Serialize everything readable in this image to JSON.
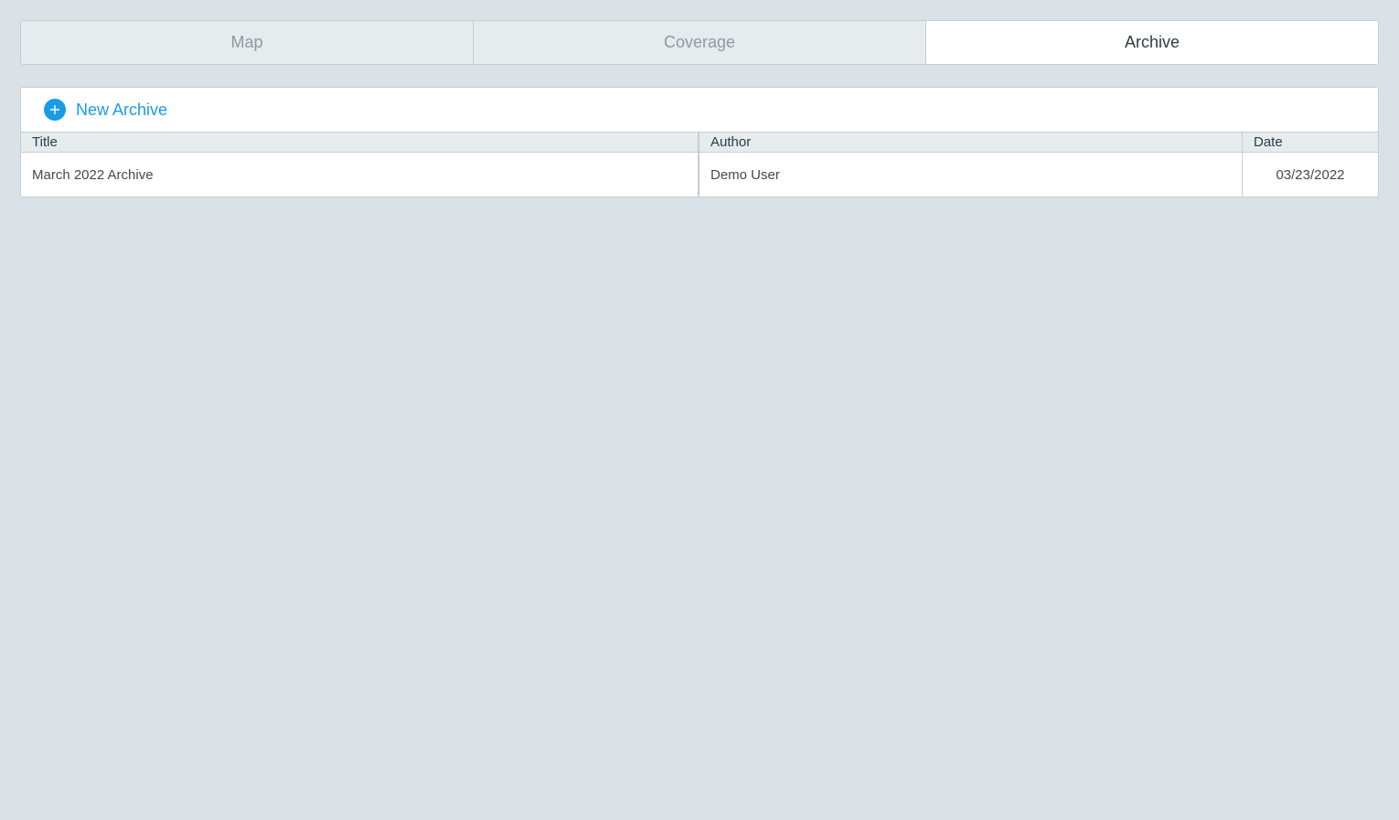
{
  "tabs": [
    {
      "label": "Map",
      "active": false
    },
    {
      "label": "Coverage",
      "active": false
    },
    {
      "label": "Archive",
      "active": true
    }
  ],
  "toolbar": {
    "new_button_label": "New Archive",
    "new_button_icon": "plus-circle-icon"
  },
  "table": {
    "columns": [
      "Title",
      "Author",
      "Date"
    ],
    "rows": [
      {
        "title": "March 2022 Archive",
        "author": "Demo User",
        "date": "03/23/2022"
      }
    ]
  },
  "colors": {
    "accent": "#1a9be6",
    "background": "#dae2e8",
    "header_bg": "#e6ebee",
    "border": "#c5ced5"
  }
}
